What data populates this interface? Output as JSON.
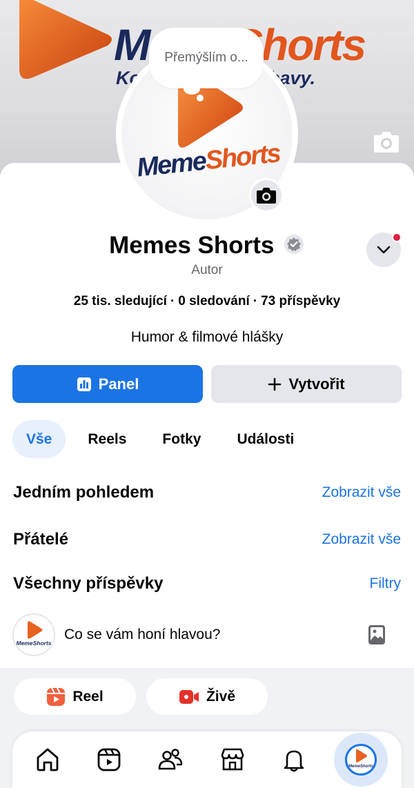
{
  "cover": {
    "brand_text_a": "Meme",
    "brand_text_b": "Shorts",
    "tagline": "Ko",
    "tagline_end": "ábavy.",
    "camera_icon": "camera-icon"
  },
  "thought_bubble": {
    "text": "Přemýšlím o..."
  },
  "avatar": {
    "brand_a": "Meme",
    "brand_b": "Shorts"
  },
  "profile": {
    "name": "Memes Shorts",
    "role": "Autor",
    "followers": "25 tis. sledující",
    "following": "0 sledování",
    "posts": "73 příspěvky",
    "separator": "·",
    "bio": "Humor & filmové hlášky"
  },
  "actions": {
    "primary": "Panel",
    "secondary": "Vytvořit"
  },
  "tabs": [
    {
      "label": "Vše",
      "active": true
    },
    {
      "label": "Reels",
      "active": false
    },
    {
      "label": "Fotky",
      "active": false
    },
    {
      "label": "Události",
      "active": false
    }
  ],
  "sections": {
    "glance_title": "Jedním pohledem",
    "glance_link": "Zobrazit vše",
    "friends_title": "Přátelé",
    "friends_link": "Zobrazit vše",
    "posts_title": "Všechny příspěvky",
    "posts_link": "Filtry"
  },
  "composer": {
    "prompt": "Co se vám honí hlavou?",
    "avatar_text": "MemeShorts"
  },
  "quick_actions": {
    "reel": "Reel",
    "live": "Živě"
  },
  "nav": {
    "items": [
      "home-icon",
      "video-icon",
      "friends-icon",
      "marketplace-icon",
      "bell-icon",
      "profile-avatar"
    ]
  },
  "colors": {
    "accent": "#1b74e4",
    "brand_orange": "#e2561d",
    "brand_navy": "#1b2a5c",
    "notification": "#e41e3f"
  }
}
